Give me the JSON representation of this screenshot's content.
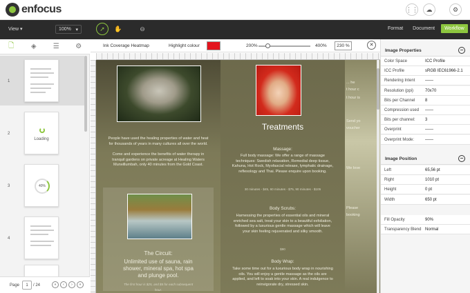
{
  "header": {
    "logo_text": "enfocus",
    "icons": [
      "grid-icon",
      "cloud-upload-icon",
      "settings-icon"
    ]
  },
  "toolbar": {
    "view_label": "View",
    "zoom_value": "100%",
    "tools": [
      "select-tool-icon",
      "hand-tool-icon",
      "zoom-tool-icon"
    ],
    "mode_tabs": [
      {
        "label": "Format",
        "active": false
      },
      {
        "label": "Document",
        "active": false
      },
      {
        "label": "Workflow",
        "active": true
      }
    ]
  },
  "left_panel": {
    "tabs": [
      "pages-icon",
      "layers-icon",
      "list-icon",
      "settings-doc-icon"
    ],
    "pages": [
      {
        "num": "1",
        "state": "thumb"
      },
      {
        "num": "2",
        "state": "loading",
        "label": "Loading"
      },
      {
        "num": "3",
        "state": "progress",
        "progress_label": "40%",
        "progress": 40
      },
      {
        "num": "4",
        "state": "thumb"
      }
    ],
    "pager": {
      "label": "Page",
      "current": "1",
      "total": "/ 24"
    }
  },
  "heatmap": {
    "title": "Ink Coverage Heatmap",
    "highlight_label": "Highlight colour",
    "highlight_color": "#e3141d",
    "min_label": "200%",
    "max_label": "400%",
    "value": "230 %",
    "slider_value": 230
  },
  "document": {
    "col1": {
      "intro": "People have used the healing properties of water and heat for thousands of years in many cultures all over the world.",
      "intro2": "Come and experience the benefits of water therapy in tranquil gardens on private acreage at Healing Waters Murwillumbah, only 40 minutes from the Gold Coast.",
      "circuit_title": "The Circuit:",
      "circuit_text": "Unlimited use of sauna, rain shower, mineral spa, hot spa and plunge pool.",
      "circuit_price": "The first hour is $25, and $5 for each subsequent hour."
    },
    "col2": {
      "title": "Treatments",
      "massage_title": "Massage:",
      "massage_text": "Full body massage: We offer a range of massage techniques: Swedish relaxation, Remedial deep tissue, Kahuna, Hot Rock, Myofascial release, lymphatic drainage, reflexology and Thai. Please enquire upon booking.",
      "massage_price": "30 minutes - $45, 60 minutes - $75, 90 minutes - $105",
      "scrubs_title": "Body Scrubs:",
      "scrubs_text": "Harnessing the properties of essential oils and mineral enriched sea salt, treat your skin to a beautiful exfoliation, followed by a luxurious gentle massage which will leave your skin feeling rejuvenated and silky smooth.",
      "scrubs_price": "$90",
      "wrap_title": "Body Wrap:",
      "wrap_text": "Take some time out for a luxurious body wrap in nourishing oils. You will enjoy a gentle massage as the oils are applied, and left to soak into your skin. A real indulgence to reinvigorate dry, stressed skin."
    },
    "col3": {
      "lines": [
        "... he",
        "t hour c",
        "t hour is",
        "Send yo",
        "voucher",
        "We love",
        "Please",
        "booking"
      ]
    }
  },
  "properties": {
    "image_properties_title": "Image Properties",
    "image_properties": [
      {
        "k": "Color Space",
        "v": "ICC Profile"
      },
      {
        "k": "ICC Profile",
        "v": "sRGB IEC61966-2.1"
      },
      {
        "k": "Rendering Intent",
        "v": "——"
      },
      {
        "k": "Resolution (ppi)",
        "v": "70x70"
      },
      {
        "k": "Bits per Channel",
        "v": "8"
      },
      {
        "k": "Compression used",
        "v": "——"
      },
      {
        "k": "Bits per channel:",
        "v": "3"
      },
      {
        "k": "Overprint",
        "v": "——"
      },
      {
        "k": "Overprint Mode:",
        "v": "——"
      }
    ],
    "image_position_title": "Image Position",
    "image_position": [
      {
        "k": "Left",
        "v": "65,56 pt"
      },
      {
        "k": "Right",
        "v": "1010 pt"
      },
      {
        "k": "Height",
        "v": "0 pt"
      },
      {
        "k": "Width",
        "v": "650 pt"
      }
    ],
    "extra": [
      {
        "k": "Fill Opacity",
        "v": "90%"
      },
      {
        "k": "Transparency Blend",
        "v": "Normal"
      }
    ]
  }
}
